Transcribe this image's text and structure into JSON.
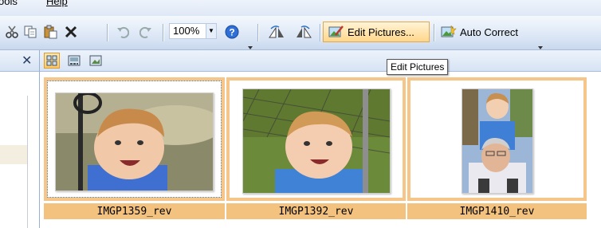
{
  "menubar": {
    "tools": "ools",
    "help": "Help"
  },
  "toolbar": {
    "zoom_value": "100%",
    "edit_pictures_label": "Edit Pictures...",
    "auto_correct_label": "Auto Correct",
    "edit_pictures_mnemonic": "i",
    "auto_correct_mnemonic": "A"
  },
  "tooltip": {
    "text": "Edit Pictures"
  },
  "pictures": [
    {
      "name": "IMGP1359_rev"
    },
    {
      "name": "IMGP1392_rev"
    },
    {
      "name": "IMGP1410_rev"
    }
  ],
  "colors": {
    "selection": "#f6c58a",
    "caption": "#f4c27f",
    "toolbar": "#d8e4f4"
  }
}
